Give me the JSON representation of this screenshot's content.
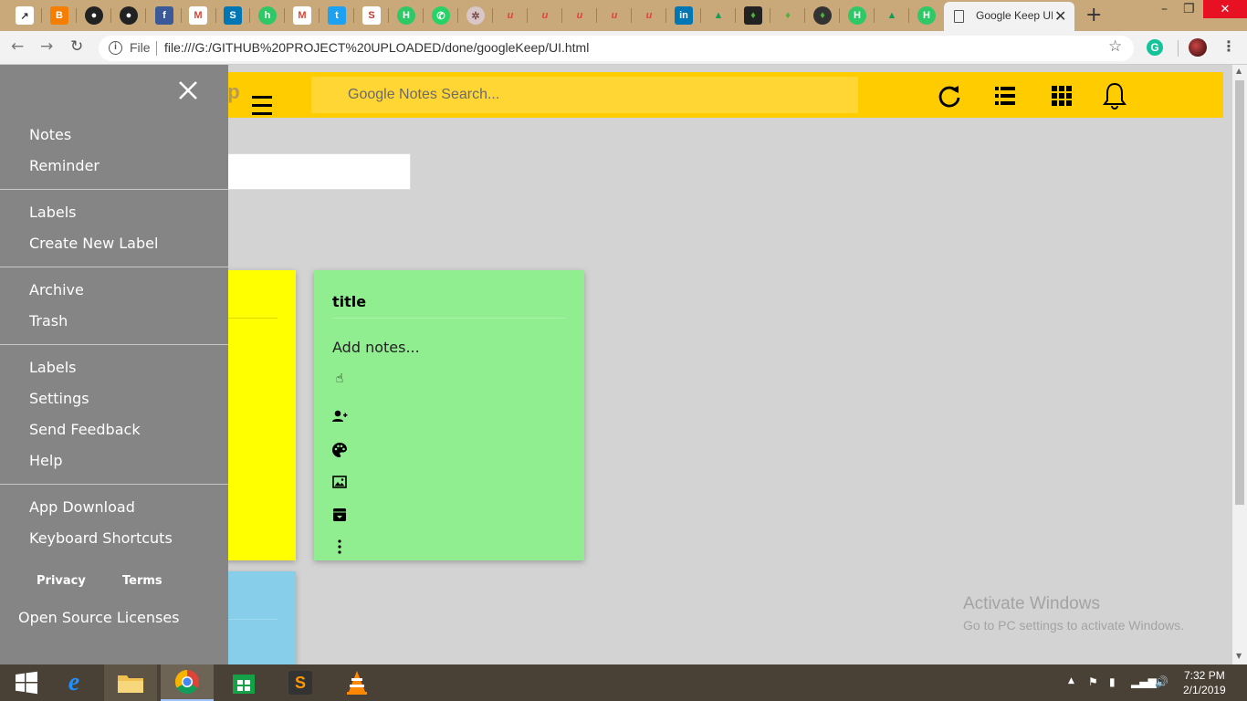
{
  "browser": {
    "active_tab_title": "Google Keep UI",
    "new_tab_symbol": "+",
    "file_label": "File",
    "url": "file:///G:/GITHUB%20PROJECT%20UPLOADED/done/googleKeep/UI.html",
    "window_controls": {
      "minimize": "–",
      "restore": "❐",
      "close": "✕"
    }
  },
  "app": {
    "brand": "ep",
    "search_placeholder": "Google Notes Search...",
    "header_color": "#ffcc00"
  },
  "drawer": {
    "close_symbol": "✕",
    "group1": [
      "Notes",
      "Reminder"
    ],
    "group2": [
      "Labels",
      "Create New Label"
    ],
    "group3": [
      "Archive",
      "Trash"
    ],
    "group4": [
      "Labels",
      "Settings",
      "Send Feedback",
      "Help"
    ],
    "group5": [
      "App Download",
      "Keyboard Shortcuts"
    ],
    "privacy": "Privacy",
    "terms": "Terms",
    "oss": "Open Source Licenses"
  },
  "note": {
    "title": "title",
    "body": "Add notes...",
    "color": "#90ee90"
  },
  "watermark": {
    "line1": "Activate Windows",
    "line2": "Go to PC settings to activate Windows."
  },
  "taskbar": {
    "time": "7:32 PM",
    "date": "2/1/2019"
  }
}
